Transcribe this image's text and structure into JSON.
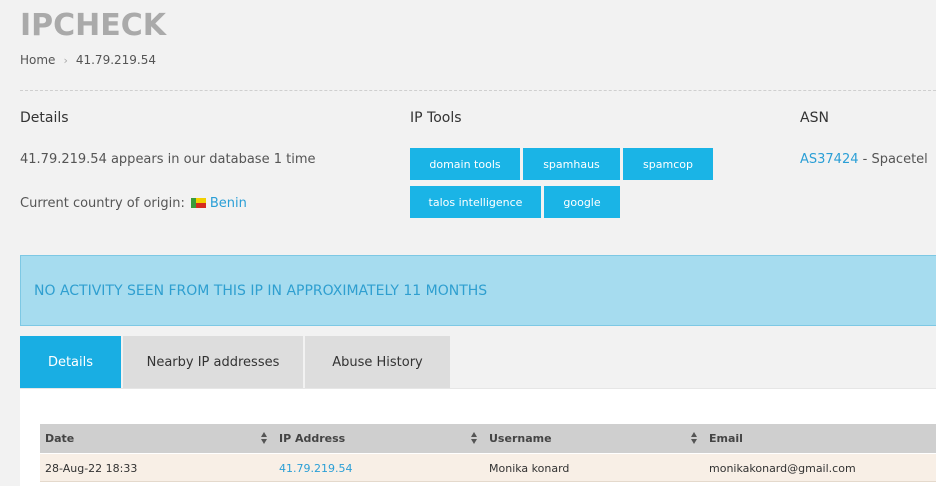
{
  "header": {
    "logo": "IPCHECK",
    "breadcrumb": {
      "home": "Home",
      "separator": "›",
      "current": "41.79.219.54"
    }
  },
  "details": {
    "title": "Details",
    "appearance": "41.79.219.54 appears in our database 1 time",
    "country_label": "Current country of origin:",
    "country": "Benin"
  },
  "ip_tools": {
    "title": "IP Tools",
    "buttons": [
      "domain tools",
      "spamhaus",
      "spamcop",
      "talos intelligence",
      "google"
    ]
  },
  "asn": {
    "title": "ASN",
    "number": "AS37424",
    "name": " - Spacetel"
  },
  "alert": {
    "text": "NO ACTIVITY SEEN FROM THIS IP IN APPROXIMATELY 11 MONTHS"
  },
  "tabs": [
    {
      "label": "Details",
      "active": true
    },
    {
      "label": "Nearby IP addresses",
      "active": false
    },
    {
      "label": "Abuse History",
      "active": false
    }
  ],
  "table": {
    "columns": [
      "Date",
      "IP Address",
      "Username",
      "Email"
    ],
    "rows": [
      [
        "28-Aug-22 18:33",
        "41.79.219.54",
        "Monika konard",
        "monikakonard@gmail.com"
      ]
    ]
  },
  "colors": {
    "accent": "#19aee3",
    "link": "#2b9fd6",
    "alert_bg": "#a6dcef",
    "row_bg": "#f8efe6"
  }
}
